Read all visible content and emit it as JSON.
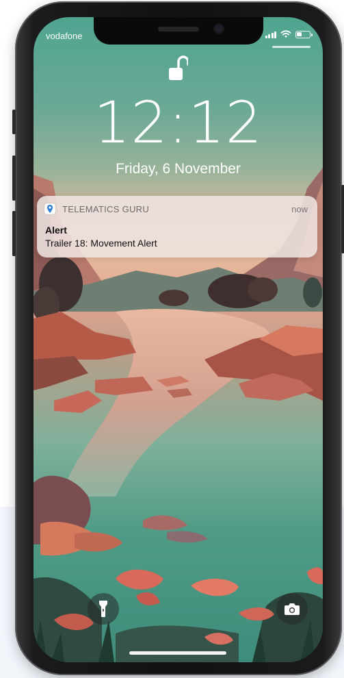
{
  "status_bar": {
    "carrier": "vodafone",
    "battery_level": 0.4,
    "icons": [
      "signal-icon",
      "wifi-icon",
      "battery-icon"
    ]
  },
  "lock_screen": {
    "lock_state_icon": "unlocked-padlock-icon",
    "time": "12:12",
    "date": "Friday, 6 November"
  },
  "notification": {
    "app_icon": "location-pin-icon",
    "app_name": "TELEMATICS GURU",
    "time": "now",
    "title": "Alert",
    "body": "Trailer 18: Movement Alert"
  },
  "quick_actions": {
    "left_icon": "flashlight-icon",
    "right_icon": "camera-icon"
  },
  "colors": {
    "pin_accent": "#2f7fd8",
    "text_light": "#ffffff"
  }
}
